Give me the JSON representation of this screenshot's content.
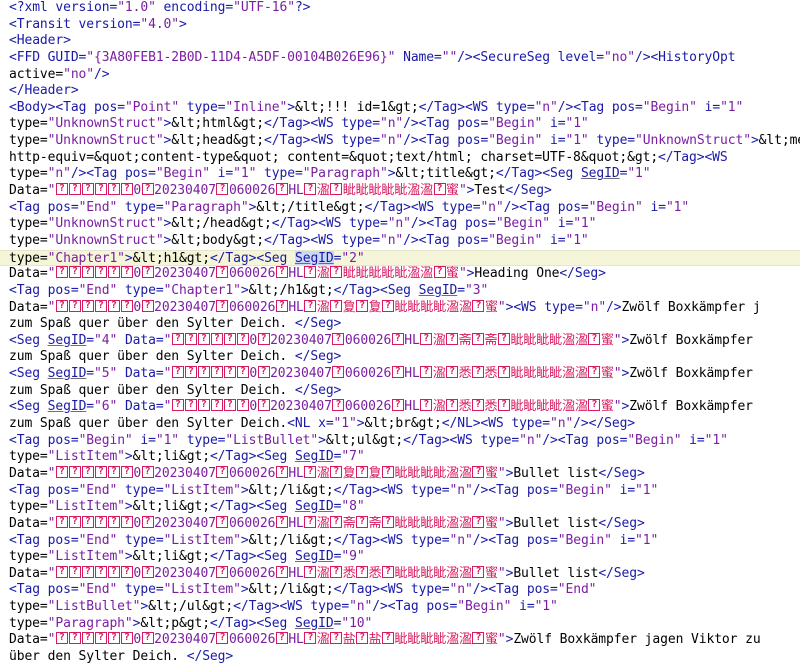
{
  "editor": {
    "lines": [
      "<?xml version=\"1.0\" encoding=\"UTF-16\"?>",
      "<Transit version=\"4.0\">",
      "<Header>",
      "<FFD GUID=\"{3A80FEB1-2B0D-11D4-A5DF-00104B026E96}\" Name=\"\"/><SecureSeg level=\"no\"/><HistoryOpt",
      "active=\"no\"/>",
      "</Header>",
      "<Body><Tag pos=\"Point\" type=\"Inline\">&lt;!!! id=1&gt;</Tag><WS type=\"n\"/><Tag pos=\"Begin\" i=\"1\"",
      "type=\"UnknownStruct\">&lt;html&gt;</Tag><WS type=\"n\"/><Tag pos=\"Begin\" i=\"1\"",
      "type=\"UnknownStruct\">&lt;head&gt;</Tag><WS type=\"n\"/><Tag pos=\"Begin\" i=\"1\" type=\"UnknownStruct\">&lt;meta",
      "http-equiv=&quot;content-type&quot; content=&quot;text/html; charset=UTF-8&quot;&gt;</Tag><WS",
      "type=\"n\"/><Tag pos=\"Begin\" i=\"1\" type=\"Paragraph\">&lt;title&gt;</Tag><Seg SegID=\"1\"",
      "Data=\"??????0?20230407?060026?HL?溋?眦眦眦眦眦溋溋?蜜\">Test</Seg>",
      "<Tag pos=\"End\" type=\"Paragraph\">&lt;/title&gt;</Tag><WS type=\"n\"/><Tag pos=\"Begin\" i=\"1\"",
      "type=\"UnknownStruct\">&lt;/head&gt;</Tag><WS type=\"n\"/><Tag pos=\"Begin\" i=\"1\"",
      "type=\"UnknownStruct\">&lt;body&gt;</Tag><WS type=\"n\"/><Tag pos=\"Begin\" i=\"1\"",
      "type=\"Chapter1\">&lt;h1&gt;</Tag><Seg SegID=\"2\"",
      "Data=\"??????0?20230407?060026?HL?溋?眦眦眦眦眦溋溋?蜜\">Heading One</Seg>",
      "<Tag pos=\"End\" type=\"Chapter1\">&lt;/h1&gt;</Tag><Seg SegID=\"3\"",
      "Data=\"??????0?20230407?060026?HL?溋?夐?夐?眦眦眦眦溋溋?蜜\"><WS type=\"n\"/>Zwölf Boxkämpfer j",
      "zum Spaß quer über den Sylter Deich. </Seg>",
      "<Seg SegID=\"4\" Data=\"??????0?20230407?060026?HL?溋?斋?斋?眦眦眦眦溋溋?蜜\">Zwölf Boxkämpfer",
      "zum Spaß quer über den Sylter Deich. </Seg>",
      "<Seg SegID=\"5\" Data=\"??????0?20230407?060026?HL?溋?悉?悉?眦眦眦眦溋溋?蜜\">Zwölf Boxkämpfer",
      "zum Spaß quer über den Sylter Deich. </Seg>",
      "<Seg SegID=\"6\" Data=\"??????0?20230407?060026?HL?溋?悉?悉?眦眦眦眦溋溋?蜜\">Zwölf Boxkämpfer",
      "zum Spaß quer über den Sylter Deich.<NL x=\"1\">&lt;br&gt;</NL><WS type=\"n\"/></Seg>",
      "<Tag pos=\"Begin\" i=\"1\" type=\"ListBullet\">&lt;ul&gt;</Tag><WS type=\"n\"/><Tag pos=\"Begin\" i=\"1\"",
      "type=\"ListItem\">&lt;li&gt;</Tag><Seg SegID=\"7\"",
      "Data=\"??????0?20230407?060026?HL?溋?夐?夐?眦眦眦眦溋溋?蜜\">Bullet list</Seg>",
      "<Tag pos=\"End\" type=\"ListItem\">&lt;/li&gt;</Tag><WS type=\"n\"/><Tag pos=\"Begin\" i=\"1\"",
      "type=\"ListItem\">&lt;li&gt;</Tag><Seg SegID=\"8\"",
      "Data=\"??????0?20230407?060026?HL?溋?斋?斋?眦眦眦眦溋溋?蜜\">Bullet list</Seg>",
      "<Tag pos=\"End\" type=\"ListItem\">&lt;/li&gt;</Tag><WS type=\"n\"/><Tag pos=\"Begin\" i=\"1\"",
      "type=\"ListItem\">&lt;li&gt;</Tag><Seg SegID=\"9\"",
      "Data=\"??????0?20230407?060026?HL?溋?悉?悉?眦眦眦眦溋溋?蜜\">Bullet list</Seg>",
      "<Tag pos=\"End\" type=\"ListItem\">&lt;/li&gt;</Tag><WS type=\"n\"/><Tag pos=\"End\"",
      "type=\"ListBullet\">&lt;/ul&gt;</Tag><WS type=\"n\"/><Tag pos=\"Begin\" i=\"1\"",
      "type=\"Paragraph\">&lt;p&gt;</Tag><Seg SegID=\"10\"",
      "Data=\"??????0?20230407?060026?HL?溋?盐?盐?眦眦眦眦溋溋?蜜\">Zwölf Boxkämpfer jagen Viktor zu",
      "über den Sylter Deich. </Seg>"
    ],
    "current_line": 15,
    "highlighted_token": "SegID",
    "colors": {
      "tag": "#1a1aa6",
      "attribute_value": "#7b1fa2",
      "glyph_box": "#d81b60",
      "current_line_bg": "#f5f5da",
      "selection_bg": "#c9d8f4"
    }
  }
}
